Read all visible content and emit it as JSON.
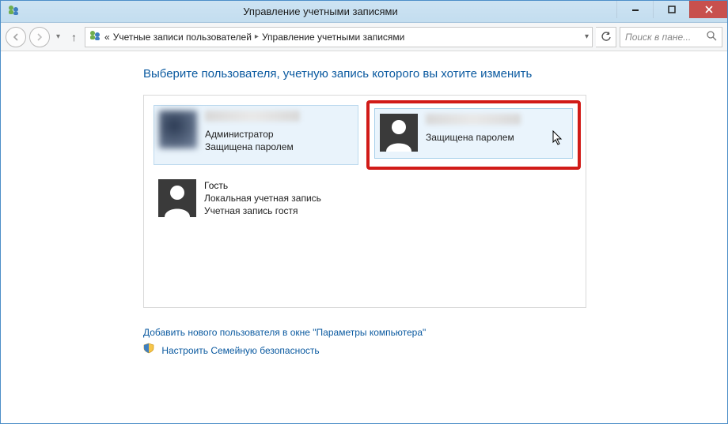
{
  "window": {
    "title": "Управление учетными записями"
  },
  "breadcrumb": {
    "prefix": "«",
    "item1": "Учетные записи пользователей",
    "item2": "Управление учетными записями"
  },
  "search": {
    "placeholder": "Поиск в пане..."
  },
  "heading": "Выберите пользователя, учетную запись которого вы хотите изменить",
  "users": {
    "u1": {
      "role": "Администратор",
      "protected": "Защищена паролем"
    },
    "u2": {
      "protected": "Защищена паролем"
    },
    "u3": {
      "name": "Гость",
      "line1": "Локальная учетная запись",
      "line2": "Учетная запись гостя"
    }
  },
  "links": {
    "add_user": "Добавить нового пользователя в окне \"Параметры компьютера\"",
    "family_safety": "Настроить Семейную безопасность"
  }
}
